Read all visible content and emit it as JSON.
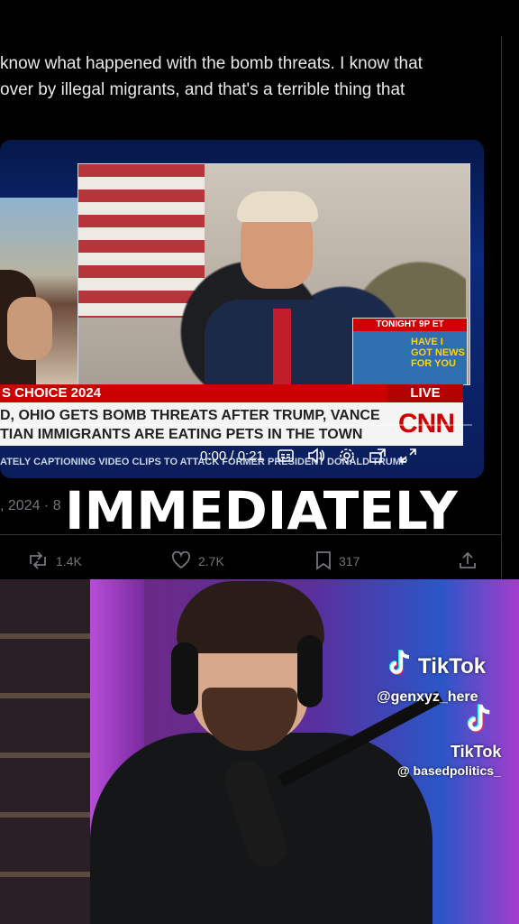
{
  "tweet": {
    "lines": [
      "know what happened with the bomb threats. I know that",
      " over by illegal migrants, and that's a terrible thing that"
    ],
    "date_fragment": ", 2024 · 8",
    "actions": {
      "retweets": "1.4K",
      "likes": "2.7K",
      "bookmarks": "317"
    }
  },
  "video": {
    "ribbon_left": "S CHOICE 2024",
    "live_label": "LIVE",
    "headline_lines": [
      "D, OHIO GETS BOMB THREATS AFTER TRUMP, VANCE",
      "TIAN IMMIGRANTS ARE EATING PETS IN THE TOWN"
    ],
    "network_logo": "CNN",
    "ticker": "ATELY CAPTIONING VIDEO CLIPS TO ATTACK FORMER PRESIDENT DONALD TRUMP",
    "promo_header": "TONIGHT 9P ET",
    "promo_title": "HAVE I GOT NEWS FOR YOU",
    "time": "0:00 / 0:21",
    "progress": 0.0
  },
  "caption": "IMMEDIATELY",
  "watermarks": {
    "brand1": "TikTok",
    "handle1": "@genxyz_here",
    "brand2": "TikTok",
    "handle2": "@ basedpolitics_"
  },
  "colors": {
    "cnn_red": "#cc0000",
    "tweet_text": "#e7e9ea",
    "muted": "#71767b"
  }
}
